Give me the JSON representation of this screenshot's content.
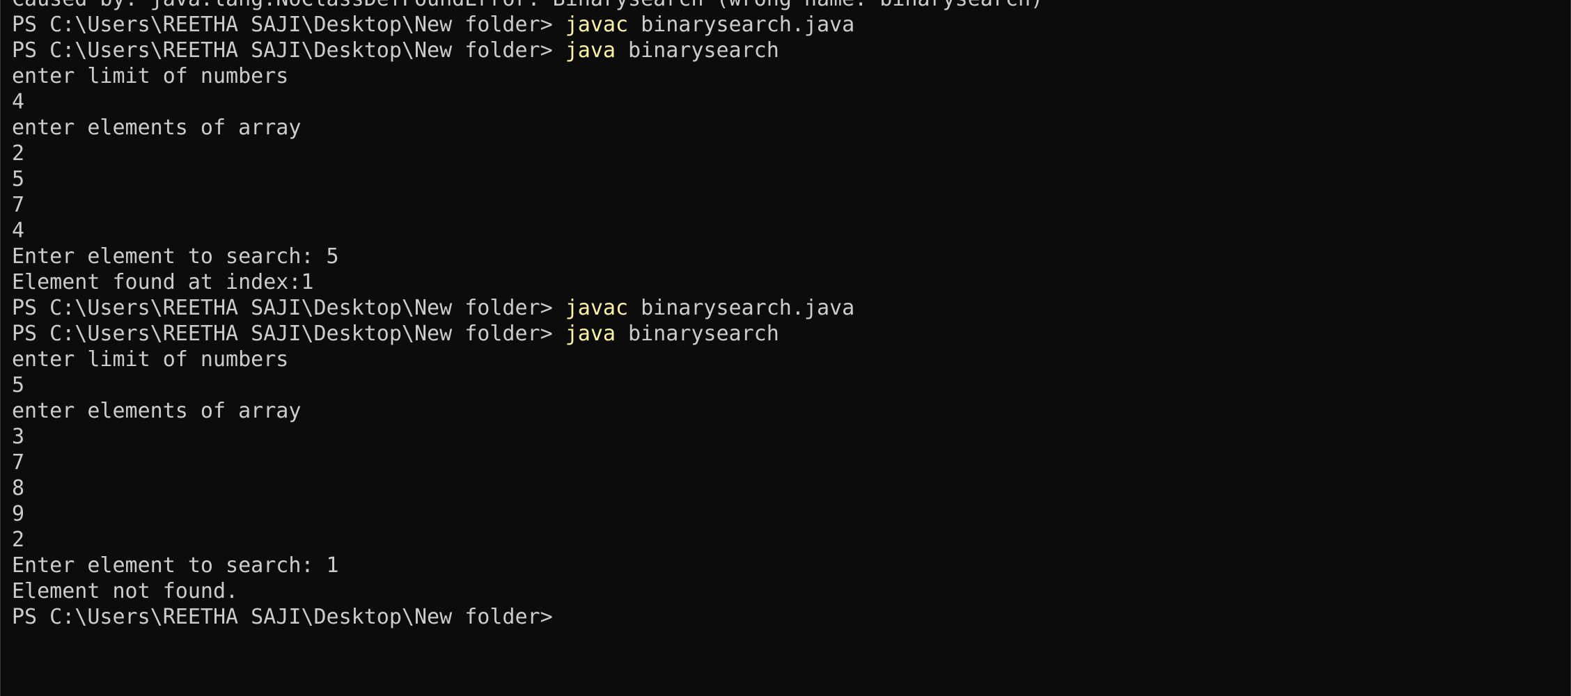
{
  "terminal": {
    "lines": [
      {
        "kind": "output",
        "text": "Caused by: java.lang.NoClassDefFoundError: Binarysearch (wrong name: binarysearch)"
      },
      {
        "kind": "prompt",
        "prompt": "PS C:\\Users\\REETHA SAJI\\Desktop\\New folder> ",
        "command": "javac",
        "args": " binarysearch.java"
      },
      {
        "kind": "prompt",
        "prompt": "PS C:\\Users\\REETHA SAJI\\Desktop\\New folder> ",
        "command": "java",
        "args": " binarysearch"
      },
      {
        "kind": "output",
        "text": "enter limit of numbers"
      },
      {
        "kind": "output",
        "text": "4"
      },
      {
        "kind": "output",
        "text": "enter elements of array"
      },
      {
        "kind": "output",
        "text": "2"
      },
      {
        "kind": "output",
        "text": "5"
      },
      {
        "kind": "output",
        "text": "7"
      },
      {
        "kind": "output",
        "text": "4"
      },
      {
        "kind": "output",
        "text": "Enter element to search: 5"
      },
      {
        "kind": "output",
        "text": "Element found at index:1"
      },
      {
        "kind": "prompt",
        "prompt": "PS C:\\Users\\REETHA SAJI\\Desktop\\New folder> ",
        "command": "javac",
        "args": " binarysearch.java"
      },
      {
        "kind": "prompt",
        "prompt": "PS C:\\Users\\REETHA SAJI\\Desktop\\New folder> ",
        "command": "java",
        "args": " binarysearch"
      },
      {
        "kind": "output",
        "text": "enter limit of numbers"
      },
      {
        "kind": "output",
        "text": "5"
      },
      {
        "kind": "output",
        "text": "enter elements of array"
      },
      {
        "kind": "output",
        "text": "3"
      },
      {
        "kind": "output",
        "text": "7"
      },
      {
        "kind": "output",
        "text": "8"
      },
      {
        "kind": "output",
        "text": "9"
      },
      {
        "kind": "output",
        "text": "2"
      },
      {
        "kind": "output",
        "text": "Enter element to search: 1"
      },
      {
        "kind": "output",
        "text": "Element not found."
      },
      {
        "kind": "prompt",
        "prompt": "PS C:\\Users\\REETHA SAJI\\Desktop\\New folder> ",
        "command": "",
        "args": ""
      }
    ]
  },
  "colors": {
    "background": "#0c0c0c",
    "text": "#cccccc",
    "command": "#f9f1a5"
  }
}
